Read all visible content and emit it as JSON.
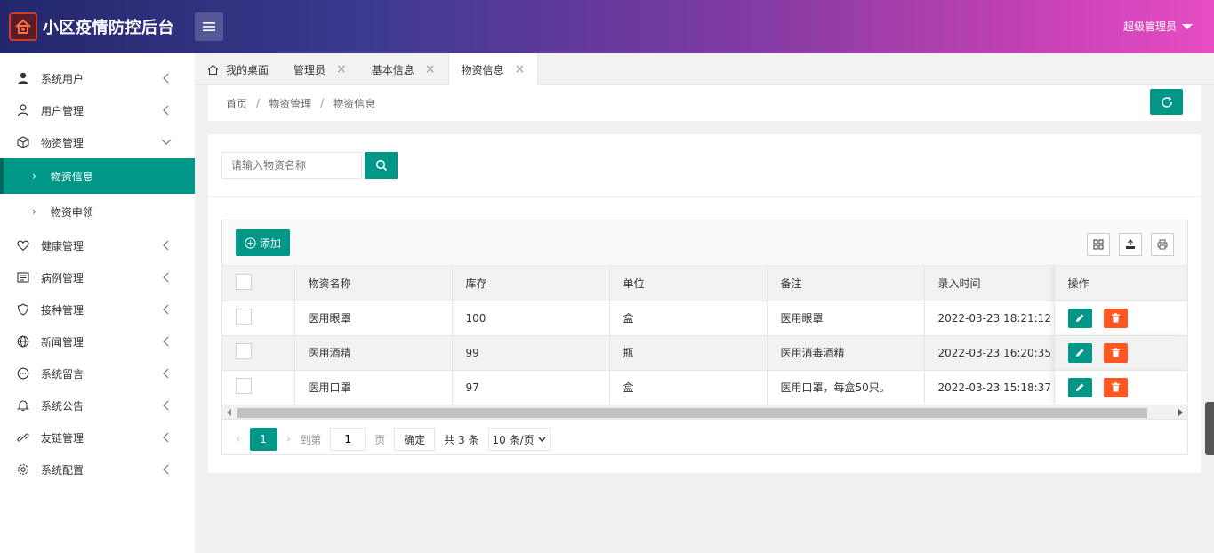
{
  "header": {
    "title": "小区疫情防控后台",
    "user_label": "超级管理员"
  },
  "sidebar": {
    "items": [
      {
        "label": "系统用户",
        "icon": "user-solid-icon"
      },
      {
        "label": "用户管理",
        "icon": "user-outline-icon"
      },
      {
        "label": "物资管理",
        "icon": "box-icon",
        "expanded": true,
        "children": [
          {
            "label": "物资信息",
            "active": true
          },
          {
            "label": "物资申领"
          }
        ]
      },
      {
        "label": "健康管理",
        "icon": "heart-icon"
      },
      {
        "label": "病例管理",
        "icon": "list-icon"
      },
      {
        "label": "接种管理",
        "icon": "shield-icon"
      },
      {
        "label": "新闻管理",
        "icon": "globe-icon"
      },
      {
        "label": "系统留言",
        "icon": "message-icon"
      },
      {
        "label": "系统公告",
        "icon": "bell-icon"
      },
      {
        "label": "友链管理",
        "icon": "link-icon"
      },
      {
        "label": "系统配置",
        "icon": "gear-icon"
      }
    ]
  },
  "tabs": [
    {
      "label": "我的桌面",
      "icon": "home-icon"
    },
    {
      "label": "管理员"
    },
    {
      "label": "基本信息"
    },
    {
      "label": "物资信息",
      "active": true
    }
  ],
  "breadcrumb": [
    "首页",
    "物资管理",
    "物资信息"
  ],
  "search": {
    "placeholder": "请输入物资名称"
  },
  "toolbar": {
    "add_label": "添加"
  },
  "table": {
    "headers": [
      "物资名称",
      "库存",
      "单位",
      "备注",
      "录入时间",
      "操作"
    ],
    "rows": [
      {
        "name": "医用眼罩",
        "stock": "100",
        "unit": "盒",
        "remark": "医用眼罩",
        "time": "2022-03-23 18:21:12"
      },
      {
        "name": "医用酒精",
        "stock": "99",
        "unit": "瓶",
        "remark": "医用消毒酒精",
        "time": "2022-03-23 16:20:35"
      },
      {
        "name": "医用口罩",
        "stock": "97",
        "unit": "盒",
        "remark": "医用口罩，每盒50只。",
        "time": "2022-03-23 15:18:37"
      }
    ]
  },
  "pager": {
    "current": "1",
    "goto_label": "到第",
    "page_value": "1",
    "page_unit": "页",
    "ok_label": "确定",
    "total": "共 3 条",
    "per_page": "10 条/页"
  },
  "colors": {
    "primary": "#009688",
    "danger": "#ff5722"
  }
}
